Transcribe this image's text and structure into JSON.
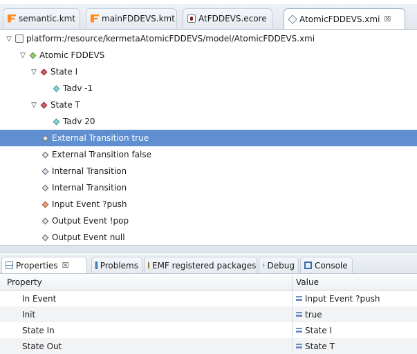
{
  "editor_tabs": [
    {
      "label": "semantic.kmt",
      "icon": "kermeta-file-icon"
    },
    {
      "label": "mainFDDEVS.kmt",
      "icon": "kermeta-file-icon"
    },
    {
      "label": "AtFDDEVS.ecore",
      "icon": "ecore-file-icon"
    },
    {
      "label": "AtomicFDDEVS.xmi",
      "icon": "xmi-file-icon",
      "active": true,
      "close": "☒"
    }
  ],
  "tree": {
    "resource": "platform:/resource/kermetaAtomicFDDEVS/model/AtomicFDDEVS.xmi",
    "root": "Atomic FDDEVS",
    "state1": "State I",
    "state1_child": "Tadv -1",
    "state2": "State T",
    "state2_child": "Tadv 20",
    "items": [
      "External Transition true",
      "External Transition false",
      "Internal Transition",
      "Internal Transition",
      "Input Event ?push",
      "Output Event !pop",
      "Output Event null"
    ]
  },
  "view_tabs": {
    "properties": "Properties",
    "properties_close": "☒",
    "problems": "Problems",
    "emf": "EMF registered packages",
    "debug": "Debug",
    "console": "Console"
  },
  "properties": {
    "col_property": "Property",
    "col_value": "Value",
    "rows": [
      {
        "name": "In Event",
        "value": "Input Event ?push"
      },
      {
        "name": "Init",
        "value": "true"
      },
      {
        "name": "State In",
        "value": "State I"
      },
      {
        "name": "State Out",
        "value": "State T"
      }
    ]
  },
  "colors": {
    "selection": "#5f8fd1",
    "accent": "#ff8a1e"
  }
}
